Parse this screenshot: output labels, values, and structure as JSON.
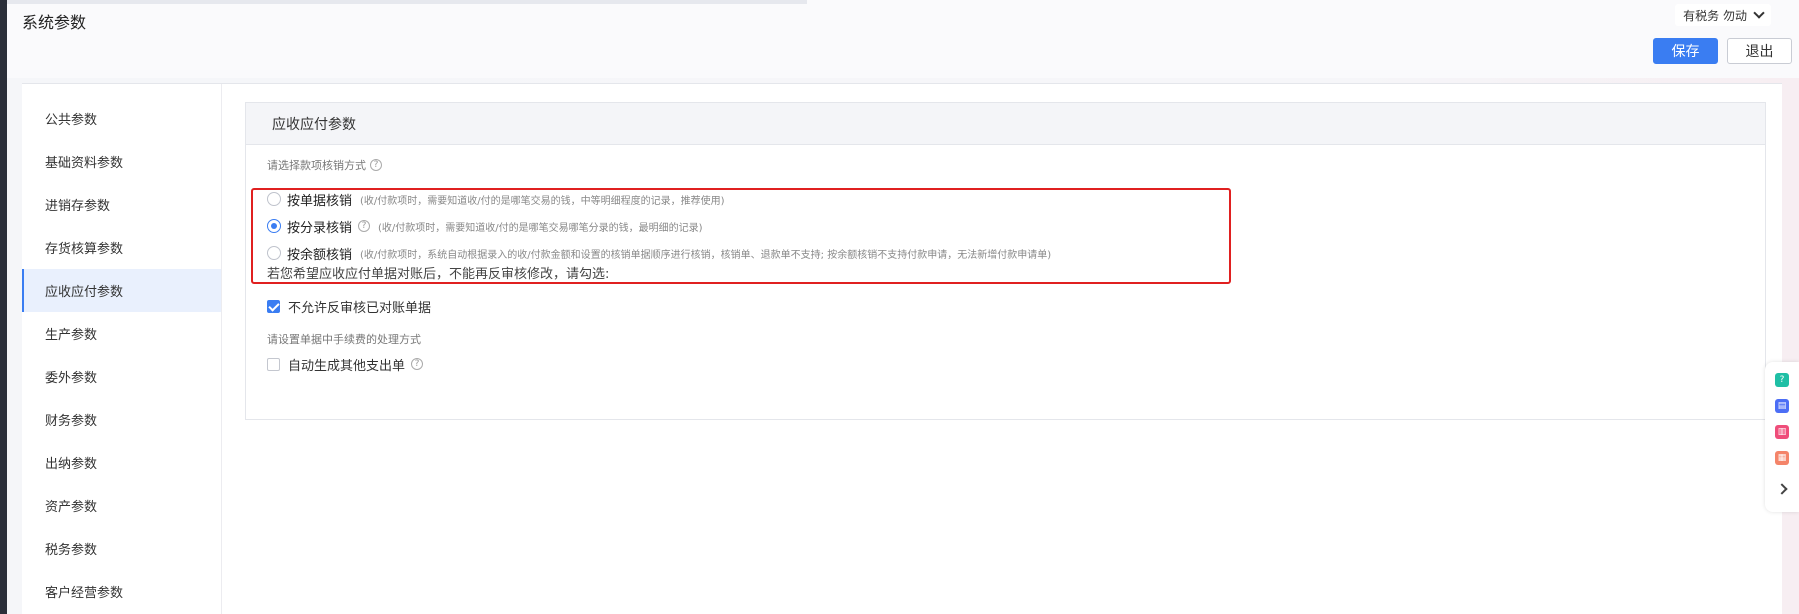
{
  "header": {
    "title": "系统参数",
    "tax_toggle": "有税务 勿动",
    "save_label": "保存",
    "exit_label": "退出"
  },
  "sidebar": {
    "items": [
      {
        "label": "公共参数",
        "active": false
      },
      {
        "label": "基础资料参数",
        "active": false
      },
      {
        "label": "进销存参数",
        "active": false
      },
      {
        "label": "存货核算参数",
        "active": false
      },
      {
        "label": "应收应付参数",
        "active": true
      },
      {
        "label": "生产参数",
        "active": false
      },
      {
        "label": "委外参数",
        "active": false
      },
      {
        "label": "财务参数",
        "active": false
      },
      {
        "label": "出纳参数",
        "active": false
      },
      {
        "label": "资产参数",
        "active": false
      },
      {
        "label": "税务参数",
        "active": false
      },
      {
        "label": "客户经营参数",
        "active": false
      }
    ]
  },
  "panel": {
    "title": "应收应付参数",
    "method_prompt": "请选择款项核销方式",
    "options": [
      {
        "label": "按单据核销",
        "desc": "(收/付款项时，需要知道收/付的是哪笔交易的钱，中等明细程度的记录，推荐使用)",
        "checked": false
      },
      {
        "label": "按分录核销",
        "desc": "(收/付款项时，需要知道收/付的是哪笔交易哪笔分录的钱，最明细的记录)",
        "checked": true
      },
      {
        "label": "按余额核销",
        "desc": "(收/付款项时，系统自动根据录入的收/付款金额和设置的核销单据顺序进行核销，核销单、退款单不支持; 按余额核销不支持付款申请，无法新增付款申请单)",
        "checked": false
      }
    ],
    "notice": "若您希望应收应付单据对账后，不能再反审核修改，请勾选:",
    "no_unaudit_label": "不允许反审核已对账单据",
    "no_unaudit_checked": true,
    "fee_prompt": "请设置单据中手续费的处理方式",
    "auto_expense_label": "自动生成其他支出单",
    "auto_expense_checked": false
  },
  "floatbar": {
    "icons": [
      {
        "name": "help-icon",
        "color": "#1fbfa5"
      },
      {
        "name": "message-icon",
        "color": "#4c6ef5"
      },
      {
        "name": "clipboard-icon",
        "color": "#ef4d7a"
      },
      {
        "name": "calendar-icon",
        "color": "#f48469"
      }
    ]
  },
  "colors": {
    "accent": "#3a7df2",
    "highlight": "#e02020"
  }
}
